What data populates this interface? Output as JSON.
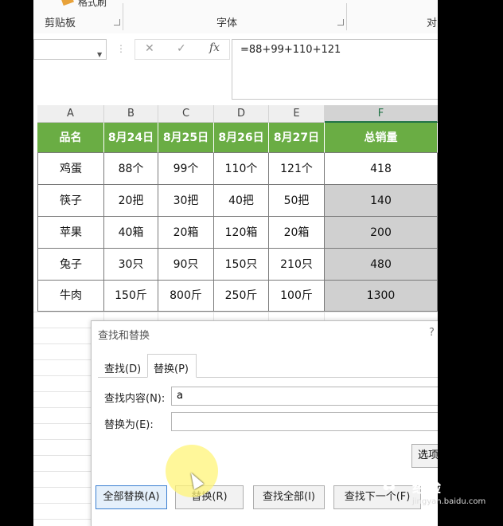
{
  "ribbon": {
    "format_painter_label": "格式刷",
    "groups": [
      "剪贴板",
      "字体",
      "对"
    ]
  },
  "formula_bar": {
    "name_box": "",
    "formula": "=88+99+110+121"
  },
  "sheet": {
    "columns": [
      "A",
      "B",
      "C",
      "D",
      "E",
      "F"
    ],
    "selected_column": "F",
    "header": [
      "品名",
      "8月24日",
      "8月25日",
      "8月26日",
      "8月27日",
      "总销量"
    ],
    "rows": [
      [
        "鸡蛋",
        "88个",
        "99个",
        "110个",
        "121个",
        "418"
      ],
      [
        "筷子",
        "20把",
        "30把",
        "40把",
        "50把",
        "140"
      ],
      [
        "苹果",
        "40箱",
        "20箱",
        "120箱",
        "20箱",
        "200"
      ],
      [
        "兔子",
        "30只",
        "90只",
        "150只",
        "210只",
        "480"
      ],
      [
        "牛肉",
        "150斤",
        "800斤",
        "250斤",
        "100斤",
        "1300"
      ]
    ],
    "colors": {
      "header_green": "#6aad44",
      "selected_gray": "#d0d0d0"
    }
  },
  "dialog": {
    "title": "查找和替换",
    "help": "?",
    "tabs": [
      "查找(D)",
      "替换(P)"
    ],
    "active_tab": "替换(P)",
    "find_label": "查找内容(N):",
    "find_value": "a",
    "replace_label": "替换为(E):",
    "replace_value": "",
    "options_button": "选项",
    "buttons": [
      "全部替换(A)",
      "替换(R)",
      "查找全部(I)",
      "查找下一个(F)"
    ]
  },
  "watermark": {
    "text": "经验",
    "url": "jingyan.baidu.com"
  }
}
